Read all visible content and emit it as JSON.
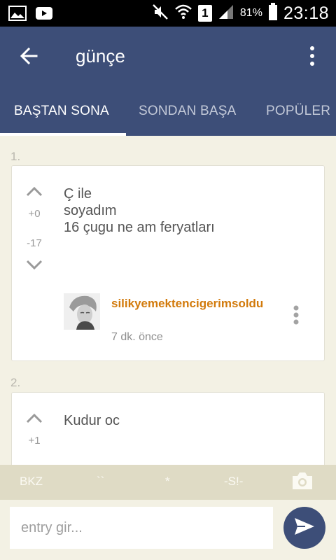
{
  "status_bar": {
    "left_icons": [
      "image-icon",
      "youtube-icon"
    ],
    "right_icons": [
      "mute-icon",
      "wifi-icon",
      "sim-icon",
      "signal-icon",
      "battery-icon"
    ],
    "sim_label": "1",
    "battery": "81%",
    "time": "23:18"
  },
  "header": {
    "title": "günçe",
    "tabs": [
      {
        "label": "BAŞTAN SONA",
        "active": true
      },
      {
        "label": "SONDAN BAŞA",
        "active": false
      },
      {
        "label": "POPÜLER",
        "active": false
      }
    ]
  },
  "entries": [
    {
      "number": "1.",
      "up_count": "+0",
      "down_count": "-17",
      "lines": [
        "Ç ile",
        "soyadım",
        "16 çugu ne am feryatları"
      ],
      "author": "silikyemektencigerimsoldu",
      "time": "7 dk. önce"
    },
    {
      "number": "2.",
      "up_count": "+1",
      "lines": [
        "Kudur oc"
      ]
    }
  ],
  "toolbar": {
    "bkz": "BKZ",
    "backtick": "``",
    "star": "*",
    "spoiler": "-S!-"
  },
  "composer": {
    "placeholder": "entry gir..."
  },
  "colors": {
    "primary": "#3d4e78",
    "author": "#d27a0b",
    "background": "#f3f1e4",
    "toolbar": "#dfdbc5"
  }
}
